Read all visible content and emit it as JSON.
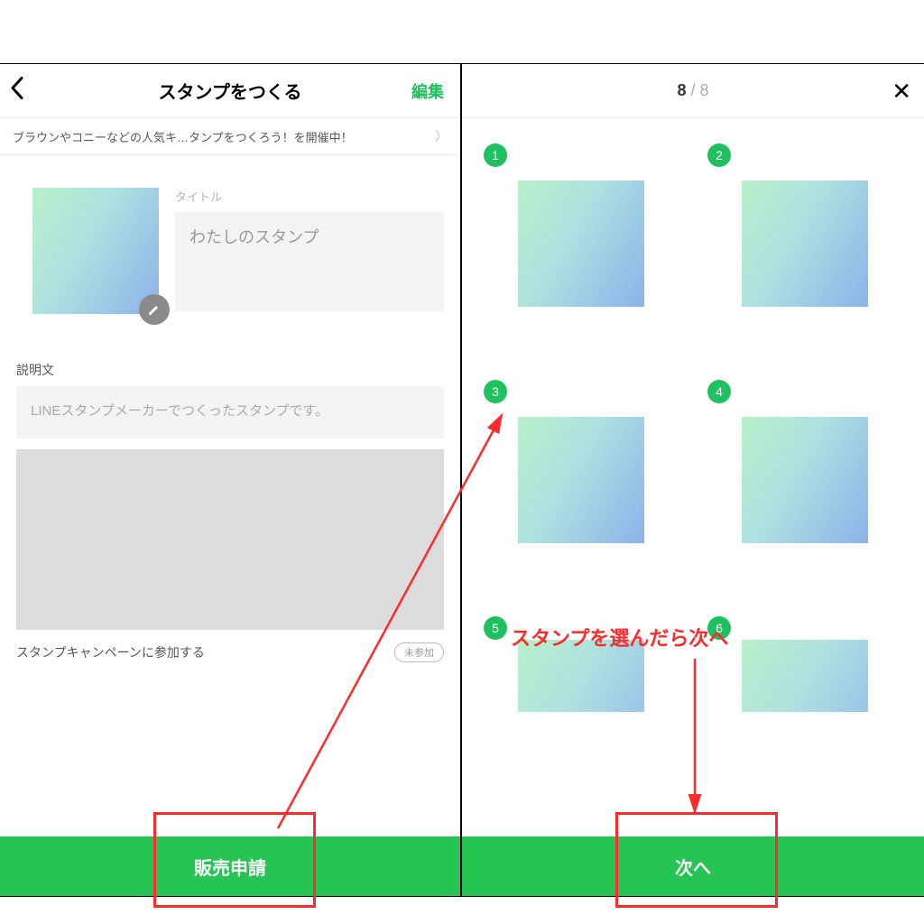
{
  "left": {
    "header": {
      "title": "スタンプをつくる",
      "edit": "編集"
    },
    "banner": "ブラウンやコニーなどの人気キ…タンプをつくろう！を開催中！",
    "title_label": "タイトル",
    "title_value": "わたしのスタンプ",
    "desc_label": "説明文",
    "desc_value": "LINEスタンプメーカーでつくったスタンプです。",
    "campaign_label": "スタンプキャンペーンに参加する",
    "campaign_pill": "未参加",
    "cta": "販売申請"
  },
  "right": {
    "counter_current": "8",
    "counter_total": "8",
    "items": [
      {
        "n": "1"
      },
      {
        "n": "2"
      },
      {
        "n": "3"
      },
      {
        "n": "4"
      },
      {
        "n": "5"
      },
      {
        "n": "6"
      }
    ],
    "cta": "次へ"
  },
  "annotation": {
    "text": "スタンプを選んだら次へ"
  }
}
